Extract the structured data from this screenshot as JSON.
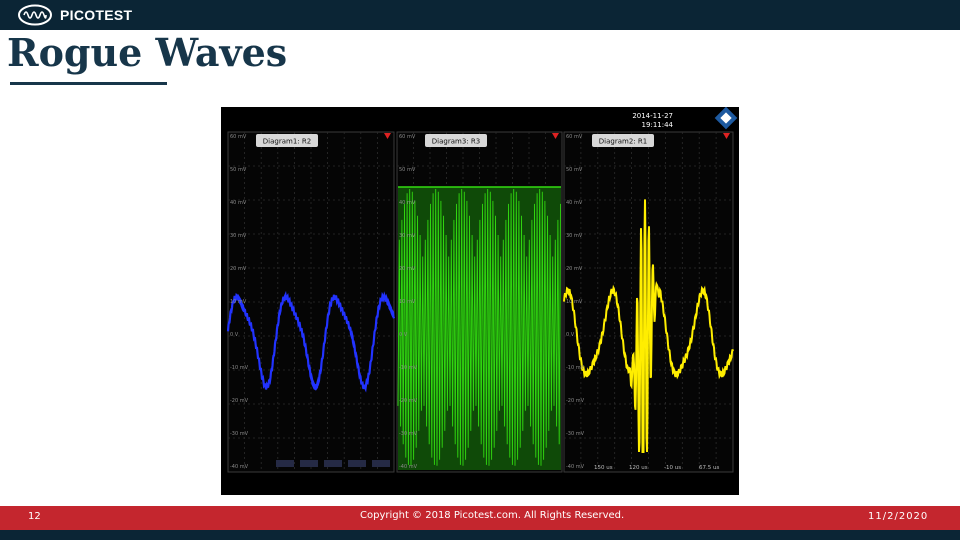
{
  "header": {
    "brand": "PICOTEST"
  },
  "slide": {
    "title": "Rogue Waves"
  },
  "scope": {
    "timestamp": [
      "2014-11-27",
      "19:11:44"
    ],
    "panels": [
      {
        "title": "Diagram1: R2",
        "trace_color": "#2233ff"
      },
      {
        "title": "Diagram3: R3",
        "trace_color": "#33dd11"
      },
      {
        "title": "Diagram2: R1",
        "trace_color": "#ffee00"
      }
    ],
    "ytick_labels": [
      "60 mV",
      "50 mV",
      "40 mV",
      "30 mV",
      "20 mV",
      "10 mV",
      "0 V",
      "-10 mV",
      "-20 mV",
      "-30 mV",
      "-40 mV"
    ],
    "xtick_labels": [
      "150 us",
      "120 us",
      "-10 us",
      "67.5 us"
    ]
  },
  "footer": {
    "page": "12",
    "copyright": "Copyright © 2018 Picotest.com. All Rights Reserved.",
    "date": "11/2/2020"
  }
}
